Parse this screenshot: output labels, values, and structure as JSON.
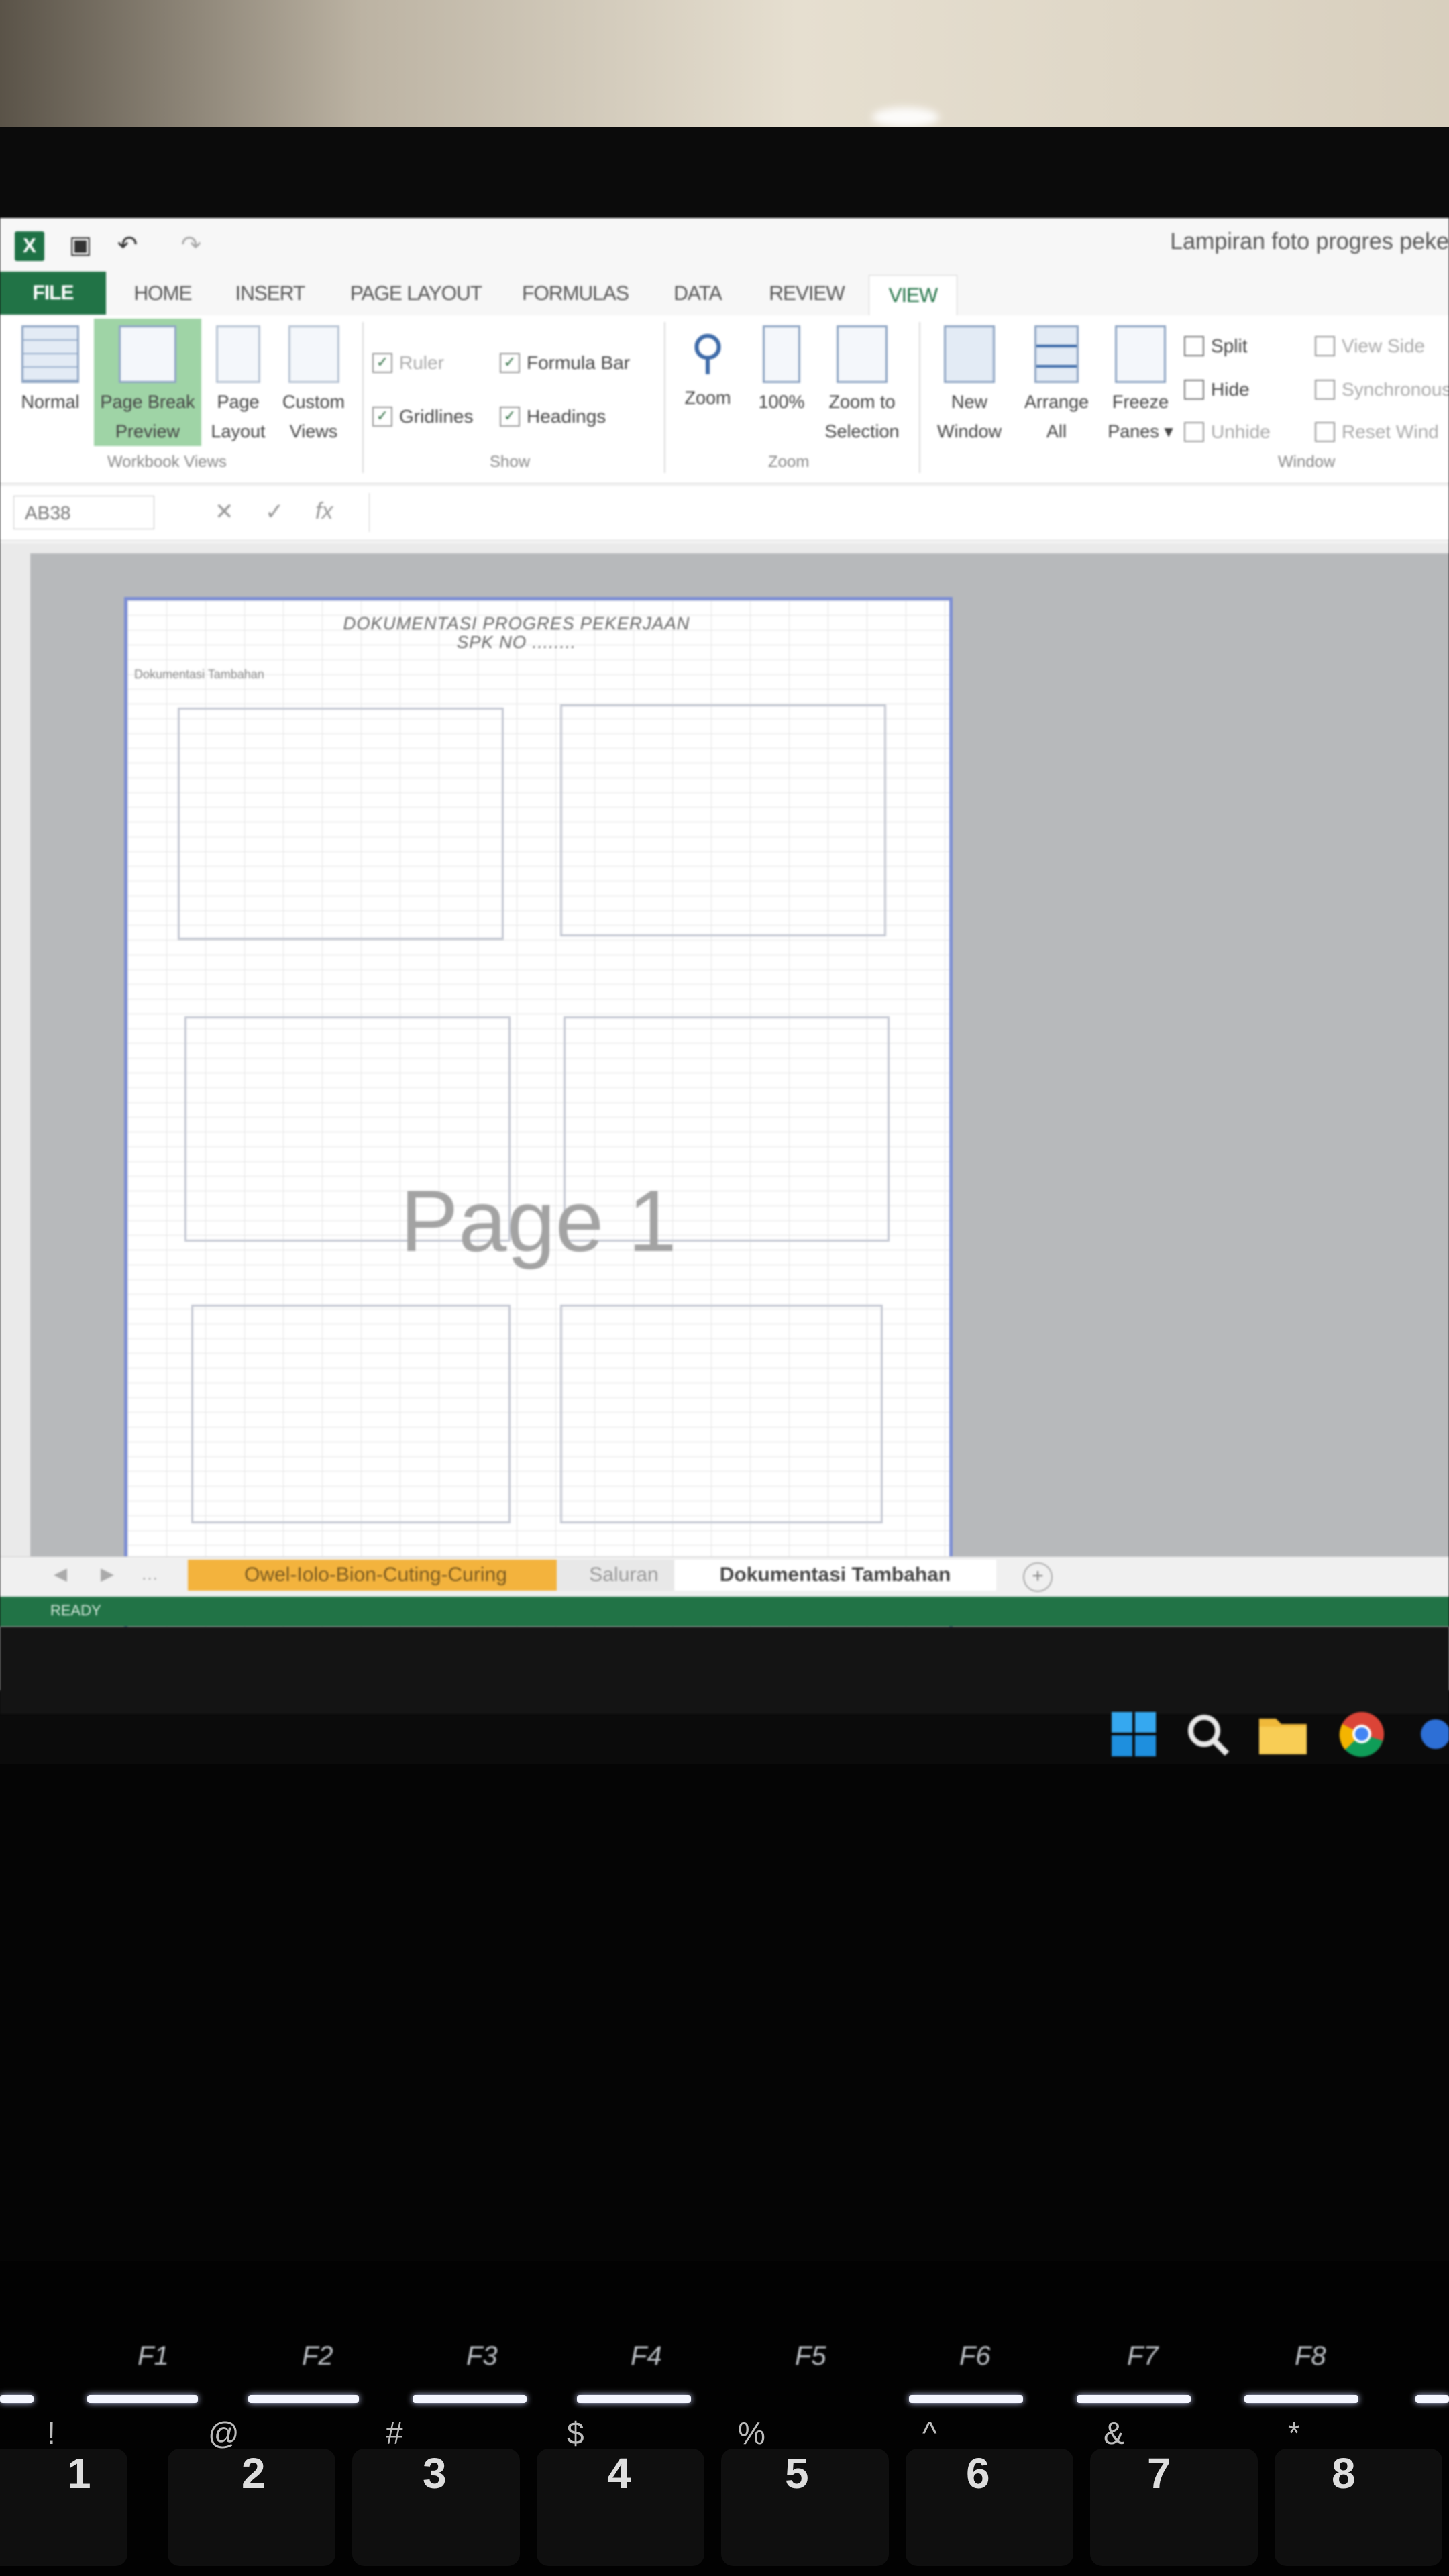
{
  "window": {
    "title": "Lampiran foto progres peke",
    "quick_access": {
      "undo_glyph": "↶",
      "redo_glyph": "↷",
      "save_glyph": "▣",
      "logo": "X"
    }
  },
  "ribbon": {
    "tabs": [
      "FILE",
      "HOME",
      "INSERT",
      "PAGE LAYOUT",
      "FORMULAS",
      "DATA",
      "REVIEW",
      "VIEW"
    ],
    "active_tab": "VIEW",
    "workbook_views": {
      "normal": "Normal",
      "page_break_preview": [
        "Page Break",
        "Preview"
      ],
      "page_layout": [
        "Page",
        "Layout"
      ],
      "custom_views": [
        "Custom",
        "Views"
      ],
      "group_label": "Workbook Views"
    },
    "show": {
      "ruler": "Ruler",
      "formula_bar": "Formula Bar",
      "gridlines": "Gridlines",
      "headings": "Headings",
      "group_label": "Show",
      "check": "✓"
    },
    "zoom": {
      "zoom": "Zoom",
      "hundred": "100%",
      "zoom_to_selection": [
        "Zoom to",
        "Selection"
      ],
      "group_label": "Zoom"
    },
    "window": {
      "new_window": [
        "New",
        "Window"
      ],
      "arrange_all": [
        "Arrange",
        "All"
      ],
      "freeze_panes": [
        "Freeze",
        "Panes ▾"
      ],
      "split": "Split",
      "hide": "Hide",
      "unhide": "Unhide",
      "view_side": "View Side",
      "synchronous": "Synchronous",
      "reset_window": "Reset Wind",
      "group_label": "Window"
    }
  },
  "formula_bar": {
    "name_box": "AB38",
    "cancel": "✕",
    "enter": "✓",
    "fx": "fx",
    "value": ""
  },
  "sheet": {
    "doc_title": "DOKUMENTASI PROGRES PEKERJAAN",
    "doc_subtitle": "SPK NO ........",
    "doc_label": "Dokumentasi Tambahan",
    "page_label": "Page 1"
  },
  "sheet_tabs": {
    "tabs": [
      "Owel-Iolo-Bion-Cuting-Curing",
      "Saluran",
      "Dokumentasi Tambahan"
    ],
    "active": "Dokumentasi Tambahan",
    "add": "+",
    "nav": [
      "◀",
      "▶",
      "…"
    ]
  },
  "status_bar": {
    "ready": "READY"
  },
  "keyboard": {
    "fkeys": [
      "F1",
      "F2",
      "F3",
      "F4",
      "F5",
      "F6",
      "F7",
      "F8"
    ],
    "numbers": [
      "1",
      "2",
      "3",
      "4",
      "5",
      "6",
      "7",
      "8"
    ],
    "symbols": [
      "!",
      "@",
      "#",
      "$",
      "%",
      "^",
      "&",
      "*"
    ]
  },
  "colors": {
    "excel_green": "#217346",
    "tab_orange": "#f3b33d",
    "page_border": "#7c8ed4"
  }
}
